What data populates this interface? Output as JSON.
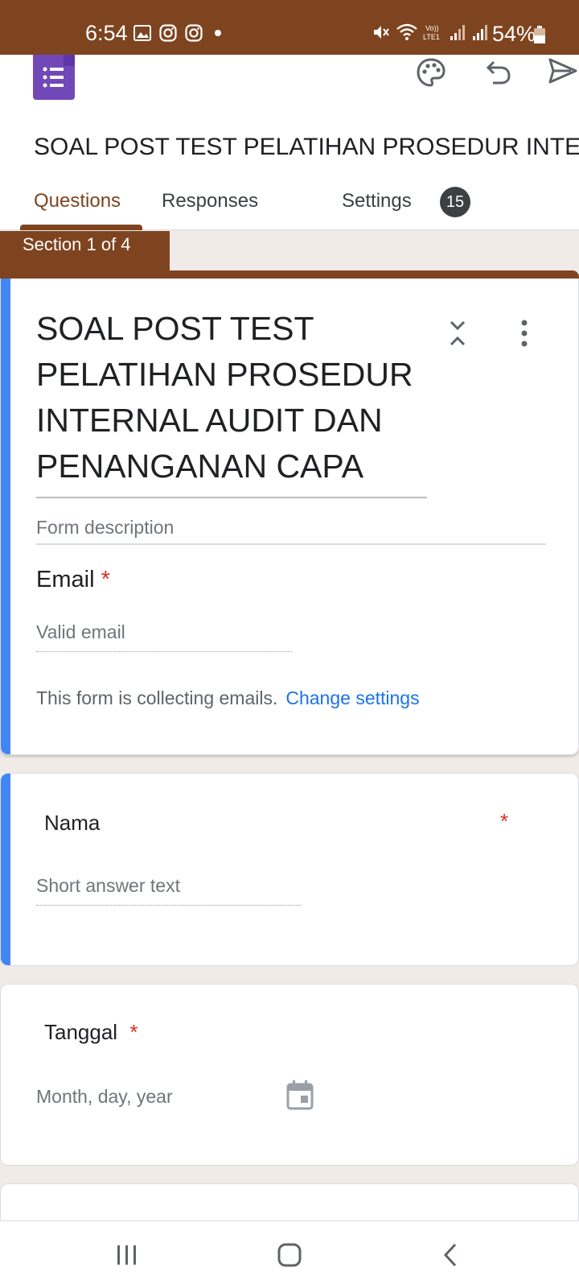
{
  "status_bar": {
    "time": "6:54",
    "battery": "54%",
    "left_icons": [
      "gallery-icon",
      "instagram-icon",
      "instagram-icon",
      "dot-icon"
    ],
    "right_icons": [
      "mute-icon",
      "wifi-icon",
      "volte-icon",
      "signal-icon",
      "signal-icon",
      "battery-icon"
    ],
    "volte_label": "Vo))\nLTE1"
  },
  "app_bar": {
    "form_title": "SOAL POST TEST PELATIHAN PROSEDUR INTERNAL AUDIT DAN PENANGANAN CAPA",
    "tabs": [
      {
        "label": "Questions",
        "active": true
      },
      {
        "label": "Responses",
        "badge": "15"
      },
      {
        "label": "Settings"
      }
    ]
  },
  "section": {
    "label": "Section 1 of 4"
  },
  "header_card": {
    "title": "SOAL POST TEST PELATIHAN PROSEDUR INTERNAL AUDIT DAN PENANGANAN CAPA",
    "description_placeholder": "Form description",
    "email_label": "Email",
    "required_mark": "*",
    "email_placeholder": "Valid email",
    "collecting_text": "This form is collecting emails.",
    "change_settings": "Change settings"
  },
  "questions": [
    {
      "label": "Nama",
      "required_mark": "*",
      "placeholder": "Short answer text"
    },
    {
      "label": "Tanggal",
      "required_mark": "*",
      "placeholder": "Month, day, year"
    }
  ],
  "colors": {
    "brand": "#7e4420",
    "accent": "#4285f4",
    "required": "#d93025",
    "link": "#1a73e8",
    "forms_logo": "#7248b9"
  }
}
